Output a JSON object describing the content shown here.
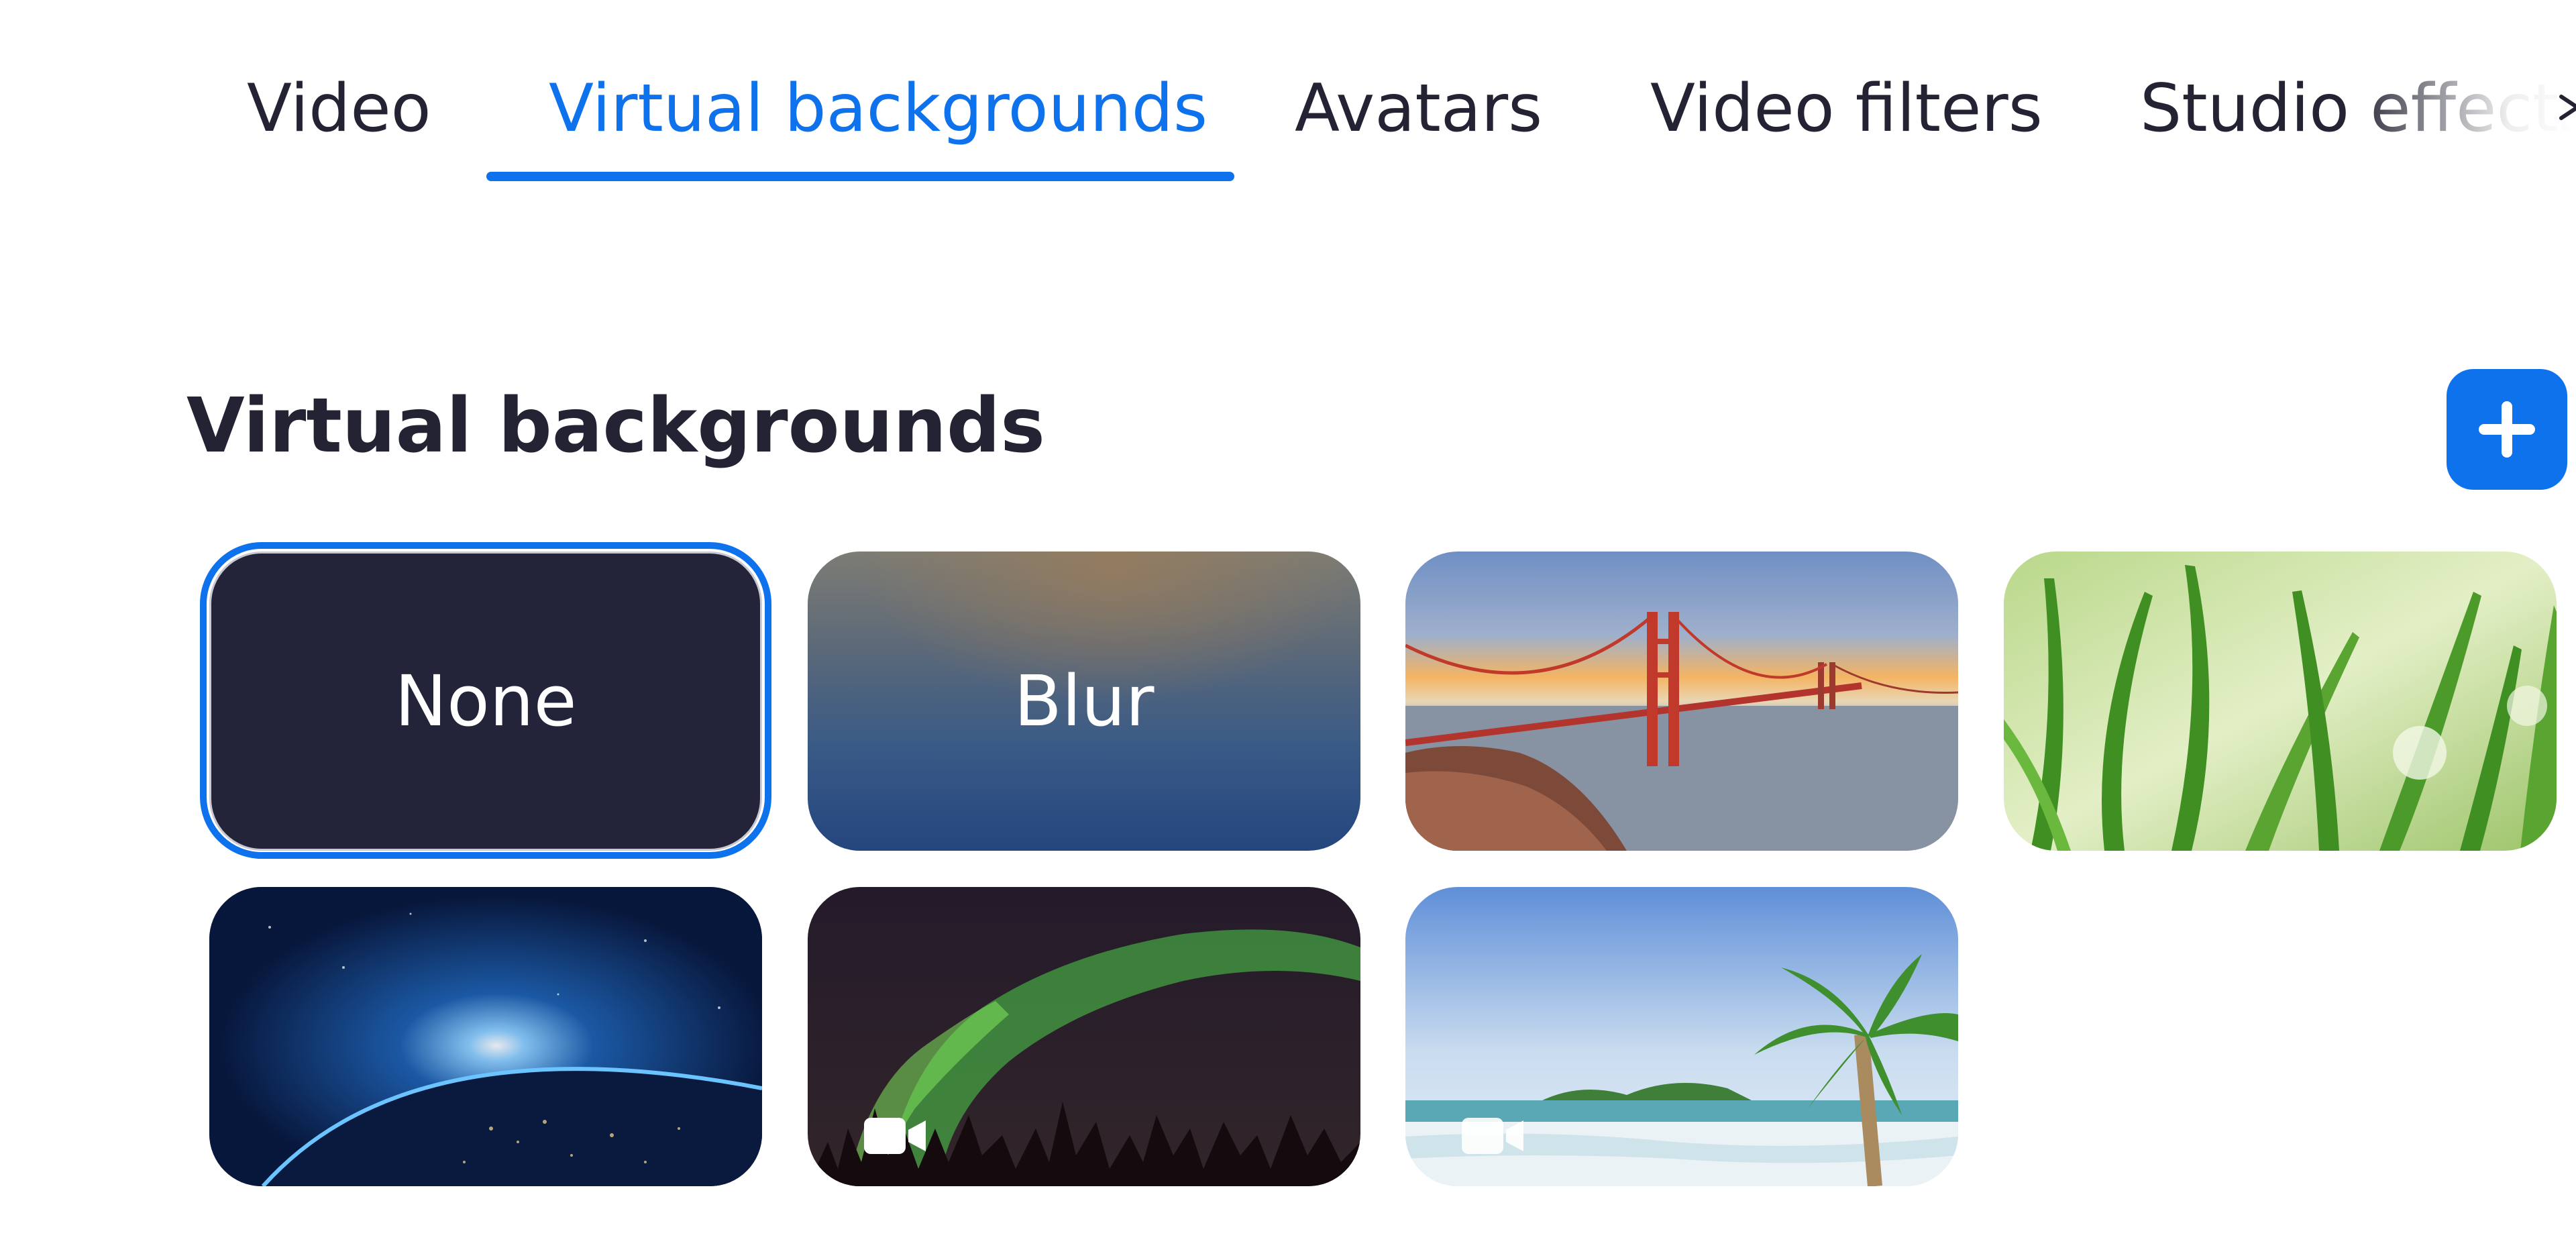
{
  "tabs": [
    {
      "label": "Video",
      "active": false
    },
    {
      "label": "Virtual backgrounds",
      "active": true
    },
    {
      "label": "Avatars",
      "active": false
    },
    {
      "label": "Video filters",
      "active": false
    },
    {
      "label": "Studio effects",
      "active": false
    }
  ],
  "section": {
    "title": "Virtual backgrounds",
    "add_icon": "plus-icon"
  },
  "backgrounds": [
    {
      "id": "none",
      "label": "None",
      "selected": true
    },
    {
      "id": "blur",
      "label": "Blur",
      "selected": false
    },
    {
      "id": "golden-gate",
      "label": "",
      "selected": false
    },
    {
      "id": "grass",
      "label": "",
      "selected": false
    },
    {
      "id": "earth",
      "label": "",
      "selected": false
    },
    {
      "id": "aurora",
      "label": "",
      "selected": false,
      "video": true
    },
    {
      "id": "beach",
      "label": "",
      "selected": false,
      "video": true
    }
  ],
  "colors": {
    "accent": "#0e72ed",
    "text": "#232333",
    "none_tile": "#23233a"
  }
}
